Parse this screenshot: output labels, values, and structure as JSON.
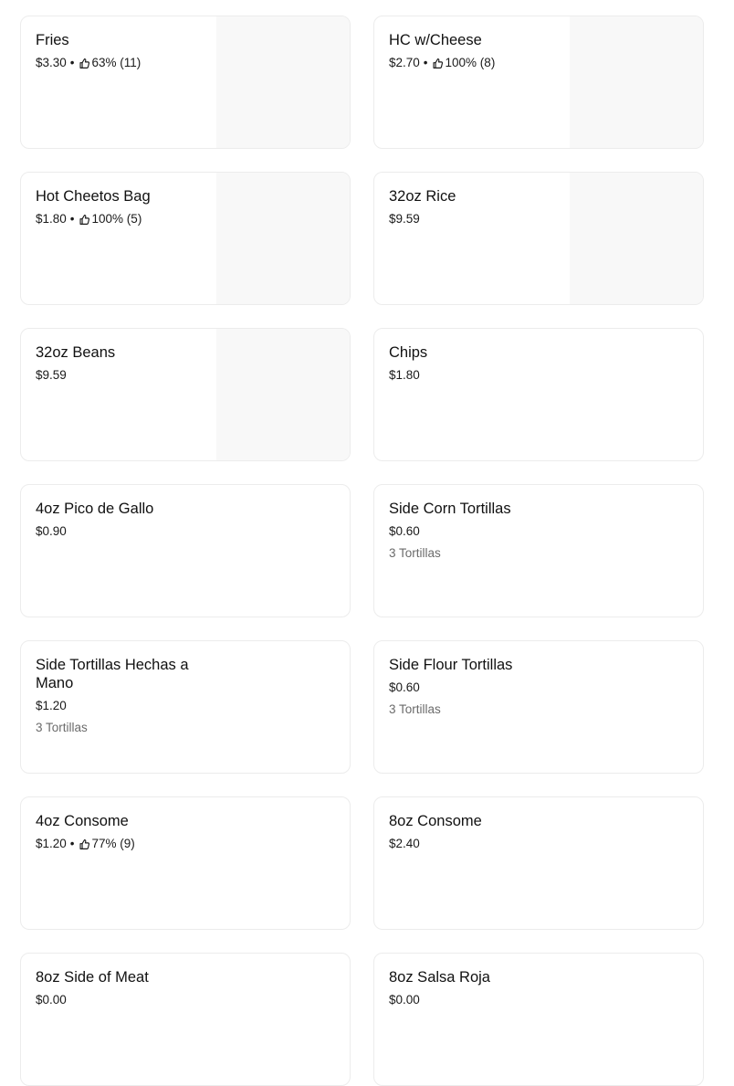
{
  "items": [
    {
      "name": "Fries",
      "price": "$3.30",
      "rating": "63% (11)",
      "description": "",
      "has_image": true
    },
    {
      "name": "HC w/Cheese",
      "price": "$2.70",
      "rating": "100% (8)",
      "description": "",
      "has_image": true
    },
    {
      "name": "Hot Cheetos Bag",
      "price": "$1.80",
      "rating": "100% (5)",
      "description": "",
      "has_image": true
    },
    {
      "name": "32oz Rice",
      "price": "$9.59",
      "rating": "",
      "description": "",
      "has_image": true
    },
    {
      "name": "32oz Beans",
      "price": "$9.59",
      "rating": "",
      "description": "",
      "has_image": true
    },
    {
      "name": "Chips",
      "price": "$1.80",
      "rating": "",
      "description": "",
      "has_image": false
    },
    {
      "name": "4oz Pico de Gallo",
      "price": "$0.90",
      "rating": "",
      "description": "",
      "has_image": false
    },
    {
      "name": "Side Corn Tortillas",
      "price": "$0.60",
      "rating": "",
      "description": "3 Tortillas",
      "has_image": false
    },
    {
      "name": "Side Tortillas Hechas a Mano",
      "price": "$1.20",
      "rating": "",
      "description": "3 Tortillas",
      "has_image": false
    },
    {
      "name": "Side Flour Tortillas",
      "price": "$0.60",
      "rating": "",
      "description": "3 Tortillas",
      "has_image": false
    },
    {
      "name": "4oz Consome",
      "price": "$1.20",
      "rating": "77% (9)",
      "description": "",
      "has_image": false
    },
    {
      "name": "8oz Consome",
      "price": "$2.40",
      "rating": "",
      "description": "",
      "has_image": false
    },
    {
      "name": "8oz Side of Meat",
      "price": "$0.00",
      "rating": "",
      "description": "",
      "has_image": false
    },
    {
      "name": "8oz Salsa Roja",
      "price": "$0.00",
      "rating": "",
      "description": "",
      "has_image": false
    }
  ],
  "icons": {
    "rating": "thumbs-up-icon"
  },
  "colors": {
    "border": "#ececec",
    "thumb_placeholder": "#f8f8f8",
    "muted_text": "#6b6b6b"
  }
}
